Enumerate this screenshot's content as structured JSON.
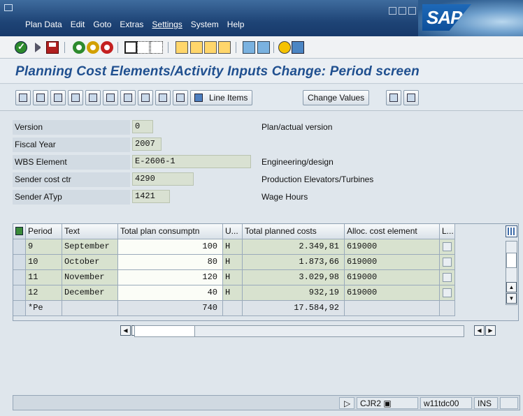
{
  "menu": {
    "items": [
      "Plan Data",
      "Edit",
      "Goto",
      "Extras",
      "Settings",
      "System",
      "Help"
    ],
    "logo_text": "SAP"
  },
  "page_title": "Planning Cost Elements/Activity Inputs Change: Period screen",
  "app_toolbar": {
    "line_items_label": "Line Items",
    "change_values_label": "Change Values"
  },
  "header_fields": {
    "version": {
      "label": "Version",
      "value": "0",
      "description": "Plan/actual version"
    },
    "fiscal_year": {
      "label": "Fiscal Year",
      "value": "2007"
    },
    "wbs_element": {
      "label": "WBS Element",
      "value": "E-2606-1",
      "description": "Engineering/design"
    },
    "sender_cost_ctr": {
      "label": "Sender cost ctr",
      "value": "4290",
      "description": "Production Elevators/Turbines"
    },
    "sender_atyp": {
      "label": "Sender ATyp",
      "value": "1421",
      "description": "Wage Hours"
    }
  },
  "table": {
    "columns": [
      "Period",
      "Text",
      "Total plan consumptn",
      "U...",
      "Total planned costs",
      "Alloc. cost element",
      "L..."
    ],
    "rows": [
      {
        "period": "9",
        "text": "September",
        "consumption": "100",
        "unit": "H",
        "costs": "2.349,81",
        "cost_element": "619000"
      },
      {
        "period": "10",
        "text": "October",
        "consumption": "80",
        "unit": "H",
        "costs": "1.873,66",
        "cost_element": "619000"
      },
      {
        "period": "11",
        "text": "November",
        "consumption": "120",
        "unit": "H",
        "costs": "3.029,98",
        "cost_element": "619000"
      },
      {
        "period": "12",
        "text": "December",
        "consumption": "40",
        "unit": "H",
        "costs": "932,19",
        "cost_element": "619000"
      }
    ],
    "total_row": {
      "period": "*Pe",
      "consumption": "740",
      "costs": "17.584,92"
    }
  },
  "status_bar": {
    "transaction": "CJR2",
    "server": "w11tdc00",
    "mode": "INS"
  }
}
